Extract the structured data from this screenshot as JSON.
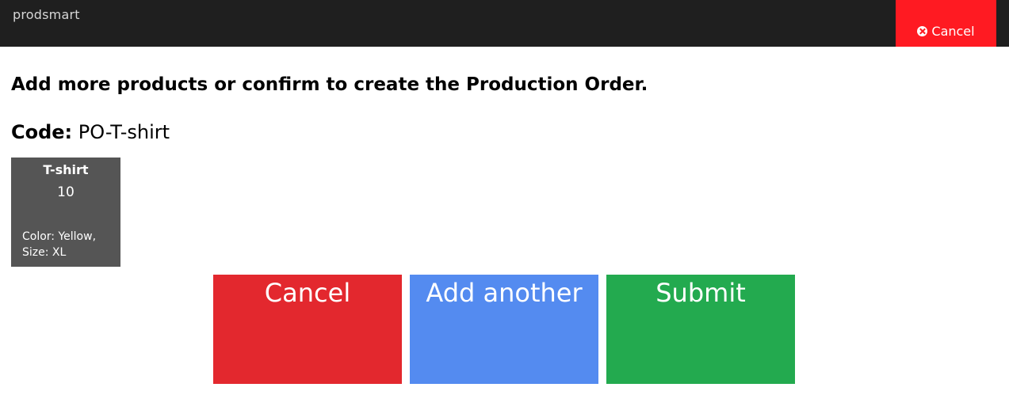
{
  "header": {
    "brand": "prodsmart",
    "cancel_label": "Cancel",
    "cancel_icon": "close-circle-icon"
  },
  "main": {
    "heading": "Add more products or confirm to create the Production Order.",
    "code_label": "Code:",
    "code_value": "PO-T-shirt"
  },
  "products": [
    {
      "name": "T-shirt",
      "quantity": "10",
      "attributes": [
        "Color: Yellow,",
        "Size: XL"
      ]
    }
  ],
  "actions": {
    "cancel": "Cancel",
    "add_another": "Add another",
    "submit": "Submit"
  },
  "colors": {
    "topbar": "#1f1f1f",
    "top_cancel": "#ff1a22",
    "card": "#555555",
    "cancel": "#e3282e",
    "add_another": "#548bf0",
    "submit": "#23aa4f"
  }
}
